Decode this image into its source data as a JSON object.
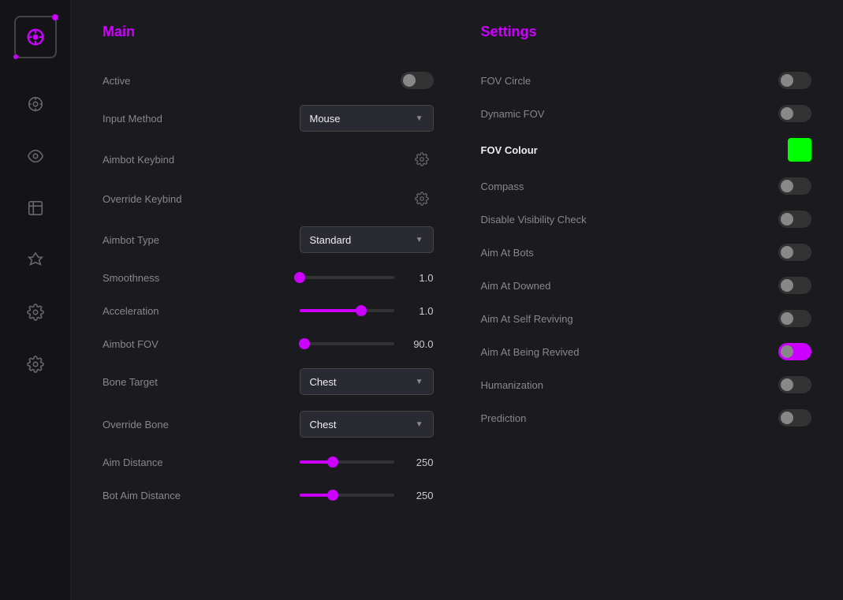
{
  "sidebar": {
    "icons": [
      {
        "name": "crosshair-icon",
        "label": "Aimbot"
      },
      {
        "name": "eye-icon",
        "label": "ESP"
      },
      {
        "name": "flask-icon",
        "label": "Items"
      },
      {
        "name": "feather-icon",
        "label": "Misc"
      },
      {
        "name": "gear-icon",
        "label": "Settings"
      },
      {
        "name": "cog-icon",
        "label": "Config"
      }
    ]
  },
  "main": {
    "title": "Main",
    "rows": [
      {
        "label": "Active",
        "type": "toggle",
        "value": false
      },
      {
        "label": "Input Method",
        "type": "dropdown",
        "value": "Mouse"
      },
      {
        "label": "Aimbot Keybind",
        "type": "gear"
      },
      {
        "label": "Override Keybind",
        "type": "gear"
      },
      {
        "label": "Aimbot Type",
        "type": "dropdown",
        "value": "Standard"
      },
      {
        "label": "Smoothness",
        "type": "slider",
        "fill_pct": 0,
        "value": "1.0"
      },
      {
        "label": "Acceleration",
        "type": "slider",
        "fill_pct": 65,
        "value": "1.0"
      },
      {
        "label": "Aimbot FOV",
        "type": "slider",
        "fill_pct": 5,
        "value": "90.0"
      },
      {
        "label": "Bone Target",
        "type": "dropdown",
        "value": "Chest"
      },
      {
        "label": "Override Bone",
        "type": "dropdown",
        "value": "Chest"
      },
      {
        "label": "Aim Distance",
        "type": "slider",
        "fill_pct": 35,
        "value": "250"
      },
      {
        "label": "Bot Aim Distance",
        "type": "slider",
        "fill_pct": 35,
        "value": "250"
      }
    ]
  },
  "settings": {
    "title": "Settings",
    "rows": [
      {
        "label": "FOV Circle",
        "type": "toggle",
        "value": false
      },
      {
        "label": "Dynamic FOV",
        "type": "toggle",
        "value": false
      },
      {
        "label": "FOV Colour",
        "type": "color",
        "value": "#00ff00"
      },
      {
        "label": "Compass",
        "type": "toggle",
        "value": false
      },
      {
        "label": "Disable Visibility Check",
        "type": "toggle",
        "value": false
      },
      {
        "label": "Aim At Bots",
        "type": "toggle",
        "value": false
      },
      {
        "label": "Aim At Downed",
        "type": "toggle",
        "value": false
      },
      {
        "label": "Aim At Self Reviving",
        "type": "toggle",
        "value": false
      },
      {
        "label": "Aim At Being Revived",
        "type": "toggle",
        "value": false
      },
      {
        "label": "Humanization",
        "type": "toggle",
        "value": false
      },
      {
        "label": "Prediction",
        "type": "toggle",
        "value": false
      }
    ]
  }
}
